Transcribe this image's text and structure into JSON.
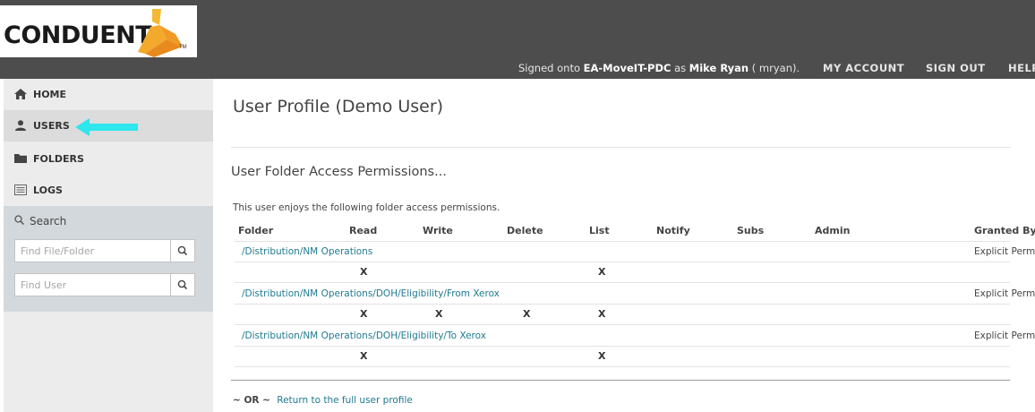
{
  "brand": {
    "logo_text": "CONDUENT",
    "tm": "TM",
    "accent": "#f0a830"
  },
  "header": {
    "signed_prefix": "Signed onto ",
    "server": "EA-MoveIT-PDC",
    "signed_mid": " as ",
    "user_name": "Mike Ryan",
    "signed_suffix": " ( mryan).",
    "links": {
      "my_account": "MY ACCOUNT",
      "sign_out": "SIGN OUT",
      "help": "HELP"
    }
  },
  "sidebar": {
    "items": [
      {
        "label": "HOME",
        "icon": "home-icon"
      },
      {
        "label": "USERS",
        "icon": "user-icon",
        "active": true
      },
      {
        "label": "FOLDERS",
        "icon": "folder-icon"
      },
      {
        "label": "LOGS",
        "icon": "logs-icon"
      }
    ],
    "annotation_arrow_color": "#2ee6ec",
    "search": {
      "heading": "Search",
      "file_placeholder": "Find File/Folder",
      "user_placeholder": "Find User"
    }
  },
  "main": {
    "title": "User Profile (Demo User)",
    "section_title": "User Folder Access Permissions...",
    "intro": "This user enjoys the following folder access permissions.",
    "columns": [
      "Folder",
      "Read",
      "Write",
      "Delete",
      "List",
      "Notify",
      "Subs",
      "Admin",
      "Granted By"
    ],
    "rows": [
      {
        "folder": "/Distribution/NM Operations",
        "granted_by": "Explicit Perm",
        "read": "X",
        "write": "",
        "delete": "",
        "list": "X"
      },
      {
        "folder": "/Distribution/NM Operations/DOH/Eligibility/From Xerox",
        "granted_by": "Explicit Perm",
        "read": "X",
        "write": "X",
        "delete": "X",
        "list": "X"
      },
      {
        "folder": "/Distribution/NM Operations/DOH/Eligibility/To Xerox",
        "granted_by": "Explicit Perm",
        "read": "X",
        "write": "",
        "delete": "",
        "list": "X"
      }
    ],
    "footer": {
      "or_text": "~ OR ~",
      "return_link": "Return to the full user profile"
    }
  }
}
